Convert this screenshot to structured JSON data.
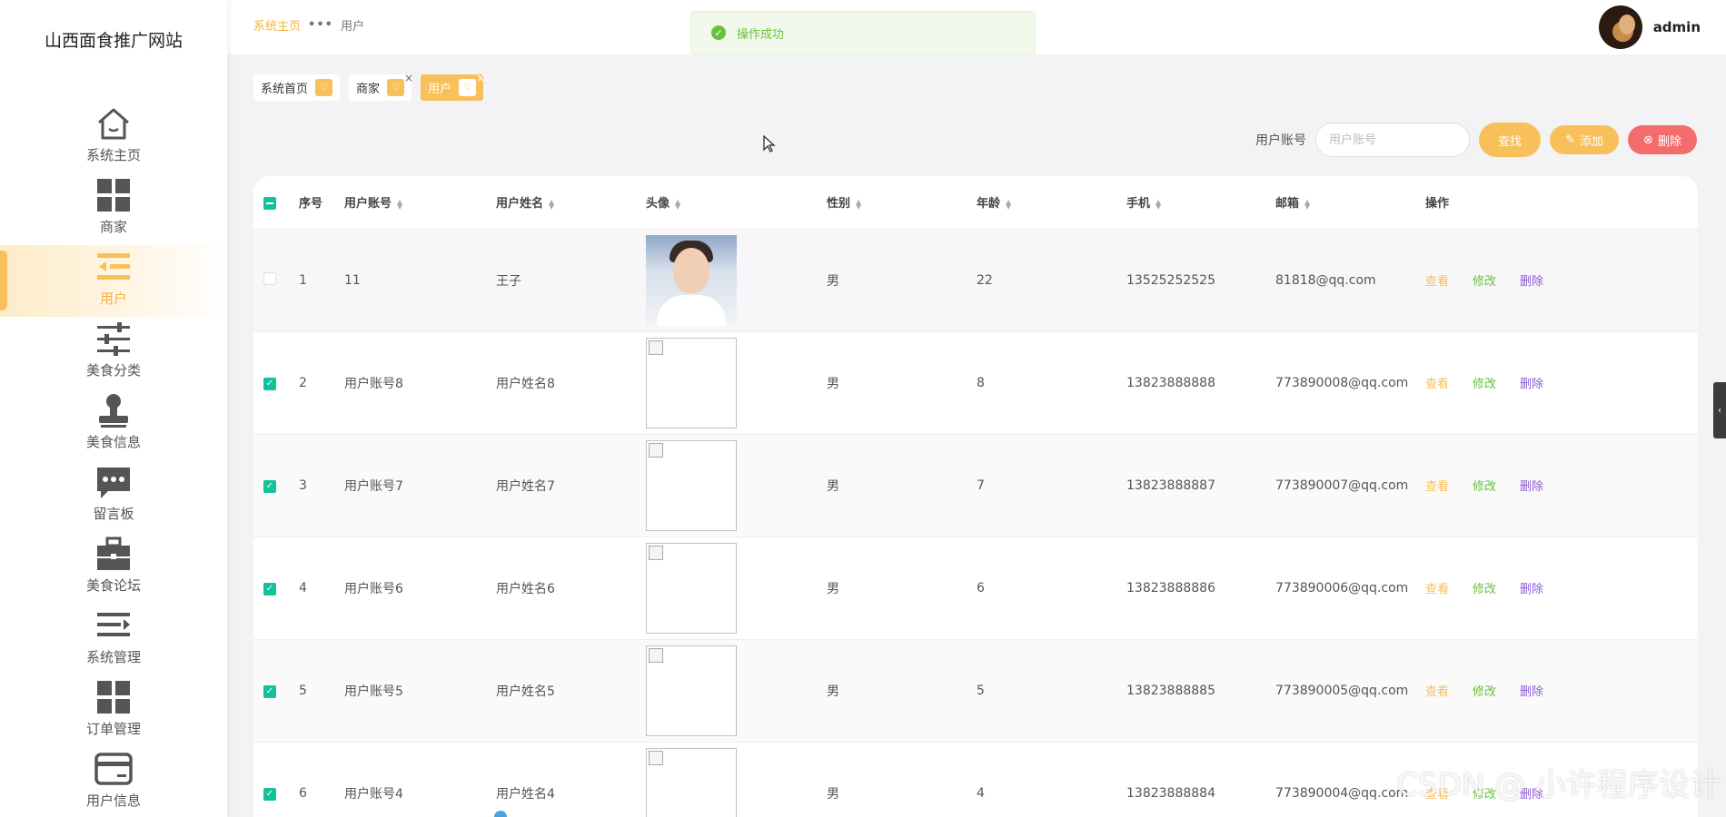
{
  "site": {
    "title": "山西面食推广网站"
  },
  "sidebar": {
    "items": [
      {
        "label": "系统主页",
        "icon": "home-icon"
      },
      {
        "label": "商家",
        "icon": "grid-icon"
      },
      {
        "label": "用户",
        "icon": "list-indent-icon",
        "active": true
      },
      {
        "label": "美食分类",
        "icon": "sliders-icon"
      },
      {
        "label": "美食信息",
        "icon": "stamp-icon"
      },
      {
        "label": "留言板",
        "icon": "chat-icon"
      },
      {
        "label": "美食论坛",
        "icon": "briefcase-icon"
      },
      {
        "label": "系统管理",
        "icon": "menu-arrow-icon"
      },
      {
        "label": "订单管理",
        "icon": "grid-icon"
      },
      {
        "label": "用户信息",
        "icon": "card-icon"
      }
    ]
  },
  "header": {
    "breadcrumb": {
      "home": "系统主页",
      "current": "用户"
    },
    "username": "admin"
  },
  "toast": {
    "message": "操作成功",
    "color": "#67c23a"
  },
  "tags": [
    {
      "label": "系统首页"
    },
    {
      "label": "商家"
    },
    {
      "label": "用户",
      "active": true
    }
  ],
  "search": {
    "label": "用户账号",
    "placeholder": "用户账号",
    "search_button": "查找",
    "add_button": "添加",
    "delete_button": "删除"
  },
  "table": {
    "columns": [
      "序号",
      "用户账号",
      "用户姓名",
      "头像",
      "性别",
      "年龄",
      "手机",
      "邮箱",
      "操作"
    ],
    "actions": {
      "view": "查看",
      "edit": "修改",
      "delete": "删除"
    },
    "rows": [
      {
        "index": "1",
        "account": "11",
        "name": "王子",
        "gender": "男",
        "age": "22",
        "phone": "13525252525",
        "email": "81818@qq.com",
        "checked": false,
        "avatar": "photo"
      },
      {
        "index": "2",
        "account": "用户账号8",
        "name": "用户姓名8",
        "gender": "男",
        "age": "8",
        "phone": "13823888888",
        "email": "773890008@qq.com",
        "checked": true,
        "avatar": "broken"
      },
      {
        "index": "3",
        "account": "用户账号7",
        "name": "用户姓名7",
        "gender": "男",
        "age": "7",
        "phone": "13823888887",
        "email": "773890007@qq.com",
        "checked": true,
        "avatar": "broken"
      },
      {
        "index": "4",
        "account": "用户账号6",
        "name": "用户姓名6",
        "gender": "男",
        "age": "6",
        "phone": "13823888886",
        "email": "773890006@qq.com",
        "checked": true,
        "avatar": "broken"
      },
      {
        "index": "5",
        "account": "用户账号5",
        "name": "用户姓名5",
        "gender": "男",
        "age": "5",
        "phone": "13823888885",
        "email": "773890005@qq.com",
        "checked": true,
        "avatar": "broken"
      },
      {
        "index": "6",
        "account": "用户账号4",
        "name": "用户姓名4",
        "gender": "男",
        "age": "4",
        "phone": "13823888884",
        "email": "773890004@qq.com",
        "checked": true,
        "avatar": "broken"
      }
    ]
  },
  "watermark": "CSDN @ 小许程序设计",
  "colors": {
    "accent": "#f8c05a",
    "danger": "#f56c6c",
    "checkbox": "#13c29a",
    "edit": "#67c23a",
    "delete_link": "#8e5bd6"
  }
}
